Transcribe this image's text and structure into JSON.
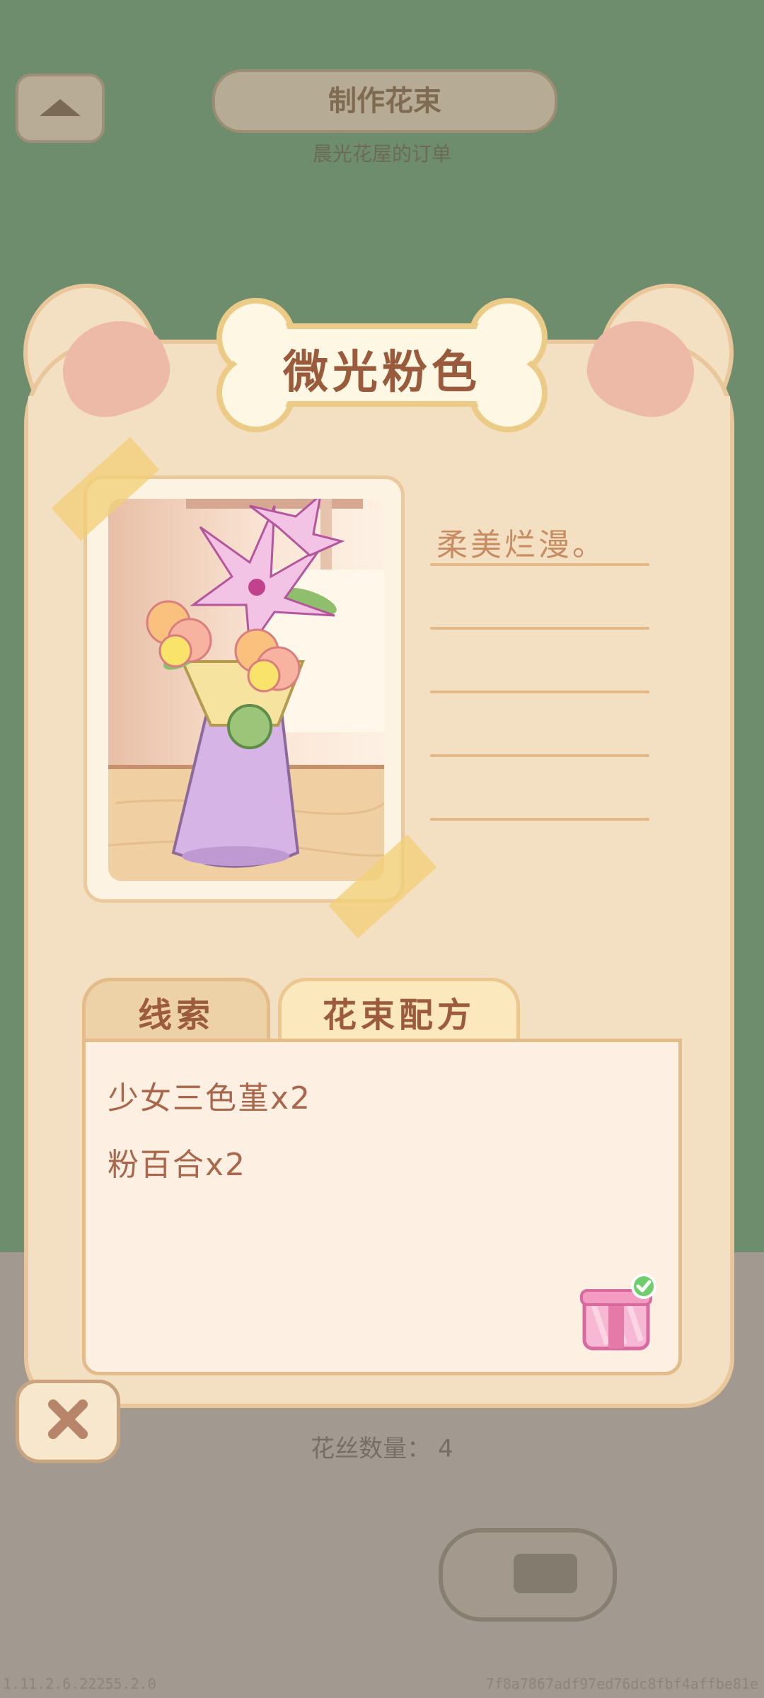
{
  "background": {
    "title": "制作花束",
    "subtitle": "晨光花屋的订单",
    "count_label": "花丝数量：",
    "count_value": "4",
    "version": "1.11.2.6.22255.2.0",
    "build_hash": "7f8a7867adf97ed76dc8fbf4affbe81e"
  },
  "card": {
    "title": "微光粉色",
    "description": "柔美烂漫。",
    "tabs": [
      {
        "label": "线索",
        "active": false
      },
      {
        "label": "花束配方",
        "active": true
      }
    ],
    "recipe": [
      {
        "text": "少女三色堇x2"
      },
      {
        "text": "粉百合x2"
      }
    ],
    "gift_status": "claimed"
  },
  "icons": {
    "close": "close-icon",
    "gift": "gift-icon",
    "check": "check-icon",
    "home": "home-icon"
  },
  "colors": {
    "card_bg": "#f3dfc2",
    "card_border": "#e9c79b",
    "title_text": "#9a5a3c",
    "ingredient_text": "#a9664a",
    "background_green": "#6e8d6c"
  }
}
